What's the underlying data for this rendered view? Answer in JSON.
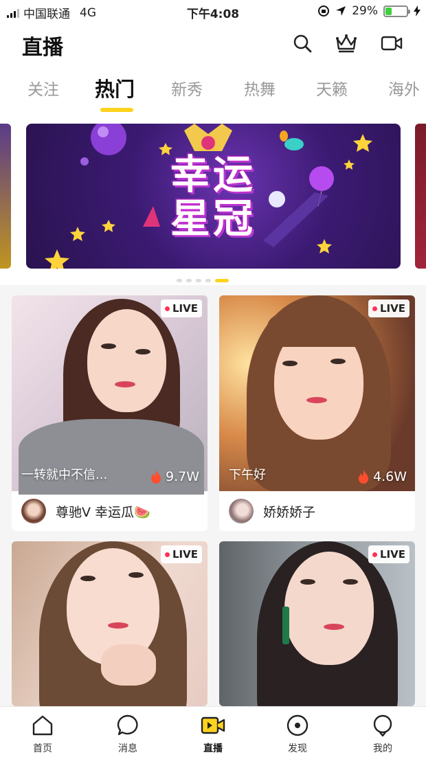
{
  "status_bar": {
    "carrier": "中国联通",
    "network": "4G",
    "time": "下午4:08",
    "battery_percent": "29%",
    "battery_level": 0.29
  },
  "header": {
    "title": "直播",
    "icons": [
      "search-icon",
      "crown-icon",
      "video-camera-icon"
    ]
  },
  "tabs": [
    {
      "label": "关注",
      "active": false
    },
    {
      "label": "热门",
      "active": true
    },
    {
      "label": "新秀",
      "active": false
    },
    {
      "label": "热舞",
      "active": false
    },
    {
      "label": "天籁",
      "active": false
    },
    {
      "label": "海外",
      "active": false
    }
  ],
  "banner": {
    "title": "幸运星冠",
    "slide_count": 5,
    "active_slide": 5
  },
  "live_badge": "LIVE",
  "streams": [
    {
      "caption": "一转就中不信...",
      "viewers": "9.7W",
      "anchor": "尊驰V 幸运瓜🍉"
    },
    {
      "caption": "下午好",
      "viewers": "4.6W",
      "anchor": "娇娇娇子"
    },
    {
      "caption": "",
      "viewers": "",
      "anchor": ""
    },
    {
      "caption": "",
      "viewers": "",
      "anchor": ""
    }
  ],
  "tabbar": [
    {
      "label": "首页",
      "icon": "home-icon",
      "active": false
    },
    {
      "label": "消息",
      "icon": "message-icon",
      "active": false
    },
    {
      "label": "直播",
      "icon": "live-camera-icon",
      "active": true
    },
    {
      "label": "发现",
      "icon": "discover-icon",
      "active": false
    },
    {
      "label": "我的",
      "icon": "profile-icon",
      "active": false
    }
  ],
  "colors": {
    "accent": "#ffd21e",
    "live_dot": "#ff3355",
    "fire": "#ff4d2e"
  }
}
